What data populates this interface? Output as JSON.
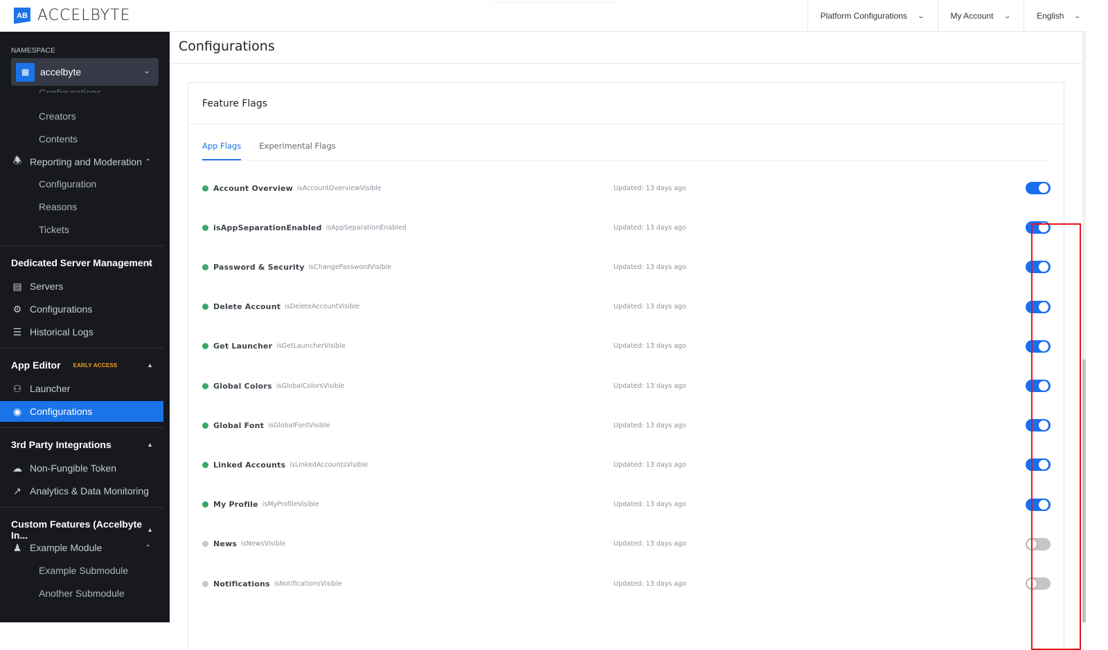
{
  "brand": {
    "name": "ACCELBYTE",
    "logo_mark": "AB"
  },
  "topbar": {
    "menus": [
      {
        "label": "Platform Configurations",
        "icon": "chevron-down-icon"
      },
      {
        "label": "My Account",
        "icon": "chevron-down-icon"
      },
      {
        "label": "English",
        "icon": "chevron-down-icon"
      }
    ]
  },
  "sidebar": {
    "namespace_label": "NAMESPACE",
    "namespace_value": "accelbyte",
    "cut_item": "Configurations",
    "items": [
      {
        "label": "Creators",
        "type": "sub"
      },
      {
        "label": "Contents",
        "type": "sub"
      },
      {
        "label": "Reporting and Moderation",
        "type": "group",
        "icon": "bell-icon",
        "expanded": true
      },
      {
        "label": "Configuration",
        "type": "sub"
      },
      {
        "label": "Reasons",
        "type": "sub"
      },
      {
        "label": "Tickets",
        "type": "sub"
      }
    ],
    "sections": [
      {
        "title": "Dedicated Server Management",
        "items": [
          {
            "label": "Servers",
            "icon": "server-icon"
          },
          {
            "label": "Configurations",
            "icon": "gear-icon"
          },
          {
            "label": "Historical Logs",
            "icon": "list-icon"
          }
        ]
      },
      {
        "title": "App Editor",
        "badge": "EARLY ACCESS",
        "items": [
          {
            "label": "Launcher",
            "icon": "gamepad-icon"
          },
          {
            "label": "Configurations",
            "icon": "toggle-icon",
            "active": true
          }
        ]
      },
      {
        "title": "3rd Party Integrations",
        "items": [
          {
            "label": "Non-Fungible Token",
            "icon": "cloud-network-icon"
          },
          {
            "label": "Analytics & Data Monitoring",
            "icon": "trending-up-icon"
          }
        ]
      },
      {
        "title": "Custom Features (Accelbyte In...",
        "items": [
          {
            "label": "Example Module",
            "icon": "users-icon",
            "expanded": true
          },
          {
            "label": "Example Submodule",
            "type": "sub"
          },
          {
            "label": "Another Submodule",
            "type": "sub"
          }
        ]
      }
    ]
  },
  "main": {
    "title": "Configurations",
    "card_title": "Feature Flags",
    "tabs": [
      {
        "label": "App Flags",
        "active": true
      },
      {
        "label": "Experimental Flags",
        "active": false
      }
    ],
    "colors": {
      "enabled_dot": "#3aa76d",
      "disabled_dot": "#c4c8cf",
      "toggle_on": "#1a6ef0",
      "toggle_off": "#c6c6c6",
      "highlight": "#e8141b"
    },
    "flags": [
      {
        "name": "Account Overview",
        "key": "isAccountOverviewVisible",
        "updated": "Updated: 13 days ago",
        "enabled": true
      },
      {
        "name": "isAppSeparationEnabled",
        "key": "isAppSeparationEnabled",
        "updated": "Updated: 13 days ago",
        "enabled": true
      },
      {
        "name": "Password & Security",
        "key": "isChangePasswordVisible",
        "updated": "Updated: 13 days ago",
        "enabled": true
      },
      {
        "name": "Delete Account",
        "key": "isDeleteAccountVisible",
        "updated": "Updated: 13 days ago",
        "enabled": true
      },
      {
        "name": "Get Launcher",
        "key": "isGetLauncherVisible",
        "updated": "Updated: 13 days ago",
        "enabled": true
      },
      {
        "name": "Global Colors",
        "key": "isGlobalColorsVisible",
        "updated": "Updated: 13 days ago",
        "enabled": true
      },
      {
        "name": "Global Font",
        "key": "isGlobalFontVisible",
        "updated": "Updated: 13 days ago",
        "enabled": true
      },
      {
        "name": "Linked Accounts",
        "key": "isLinkedAccountsVisible",
        "updated": "Updated: 13 days ago",
        "enabled": true
      },
      {
        "name": "My Profile",
        "key": "isMyProfileVisible",
        "updated": "Updated: 13 days ago",
        "enabled": true
      },
      {
        "name": "News",
        "key": "isNewsVisible",
        "updated": "Updated: 13 days ago",
        "enabled": false
      },
      {
        "name": "Notifications",
        "key": "isNotificationsVisible",
        "updated": "Updated: 13 days ago",
        "enabled": false
      }
    ]
  }
}
